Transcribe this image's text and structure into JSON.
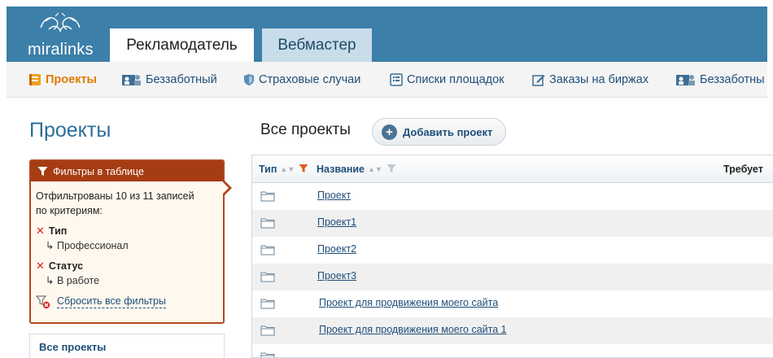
{
  "header": {
    "logo_text": "miralinks",
    "tabs": [
      {
        "label": "Рекламодатель",
        "active": true
      },
      {
        "label": "Вебмастер",
        "active": false
      }
    ]
  },
  "nav": {
    "items": [
      {
        "label": "Проекты",
        "icon": "projects-icon",
        "active": true
      },
      {
        "label": "Беззаботный",
        "icon": "users-icon",
        "active": false
      },
      {
        "label": "Страховые случаи",
        "icon": "shield-icon",
        "active": false
      },
      {
        "label": "Списки площадок",
        "icon": "list-icon",
        "active": false
      },
      {
        "label": "Заказы на биржах",
        "icon": "edit-icon",
        "active": false
      },
      {
        "label": "Беззаботны",
        "icon": "users-icon",
        "active": false
      }
    ]
  },
  "sidebar": {
    "title": "Проекты",
    "filters": {
      "header": "Фильтры в таблице",
      "summary_line1": "Отфильтрованы 10 из 11 записей",
      "summary_line2": "по критериям:",
      "criteria": [
        {
          "name": "Тип",
          "value": "Профессионал"
        },
        {
          "name": "Статус",
          "value": "В работе"
        }
      ],
      "reset_label": "Сбросить все фильтры"
    },
    "all_projects_label": "Все проекты"
  },
  "main": {
    "title": "Все проекты",
    "add_button_label": "Добавить проект",
    "table": {
      "columns": {
        "type": "Тип",
        "name": "Название",
        "required": "Требует"
      },
      "rows": [
        {
          "name": "Проект"
        },
        {
          "name": "Проект1"
        },
        {
          "name": "Проект2"
        },
        {
          "name": "Проект3"
        },
        {
          "name": "Проект для продвижения моего сайта"
        },
        {
          "name": "Проект для продвижения моего сайта 1"
        },
        {
          "name": ""
        }
      ]
    }
  },
  "colors": {
    "header_bg": "#3c7fa9",
    "accent_orange": "#e07b00",
    "filter_border": "#b0491f",
    "link": "#1f4e79"
  }
}
